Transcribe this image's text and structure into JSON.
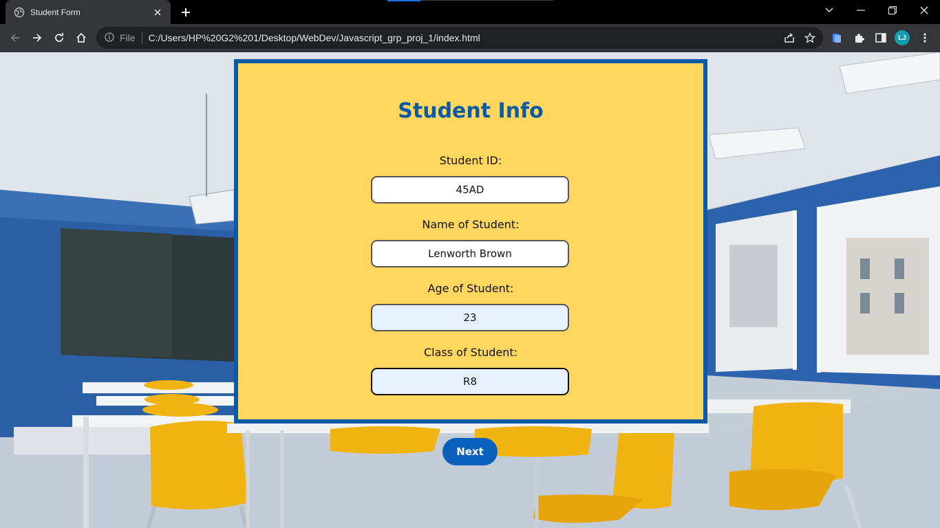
{
  "browser": {
    "tab_title": "Student Form",
    "omnibox": {
      "security_label": "File",
      "url": "C:/Users/HP%20G2%201/Desktop/WebDev/Javascript_grp_proj_1/index.html"
    },
    "profile_initials": "LJ",
    "profile_color": "#129eaf"
  },
  "form": {
    "title": "Student Info",
    "fields": [
      {
        "label": "Student ID:",
        "value": "45AD"
      },
      {
        "label": "Name of Student:",
        "value": "Lenworth Brown"
      },
      {
        "label": "Age of Student:",
        "value": "23"
      },
      {
        "label": "Class of Student:",
        "value": "R8"
      }
    ],
    "next_label": "Next"
  },
  "colors": {
    "card_background": "#ffd65e",
    "card_border": "#0b5aa6",
    "title": "#0b5aa6",
    "button": "#0b5fbd"
  }
}
